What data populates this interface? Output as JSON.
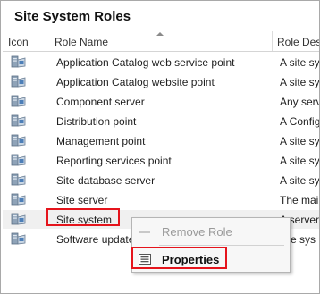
{
  "panel": {
    "title": "Site System Roles"
  },
  "columns": [
    {
      "label": "Icon"
    },
    {
      "label": "Role Name"
    },
    {
      "label": "Role Desc"
    }
  ],
  "rows": [
    {
      "name": "Application Catalog web service point",
      "desc": "A site sys"
    },
    {
      "name": "Application Catalog website point",
      "desc": "A site sys"
    },
    {
      "name": "Component server",
      "desc": "Any serv"
    },
    {
      "name": "Distribution point",
      "desc": "A Config"
    },
    {
      "name": "Management point",
      "desc": "A site sys"
    },
    {
      "name": "Reporting services point",
      "desc": "A site sys"
    },
    {
      "name": "Site database server",
      "desc": "A site sys"
    },
    {
      "name": "Site server",
      "desc": "The mair"
    },
    {
      "name": "Site system",
      "desc": "A server"
    },
    {
      "name": "Software update",
      "desc": "site sys"
    }
  ],
  "context_menu": {
    "items": [
      {
        "label": "Remove Role",
        "enabled": false,
        "icon": "remove-icon"
      },
      {
        "label": "Properties",
        "enabled": true,
        "icon": "properties-icon"
      }
    ]
  },
  "colors": {
    "highlight": "#e5141c",
    "selected_row": "#f0f0f0"
  }
}
